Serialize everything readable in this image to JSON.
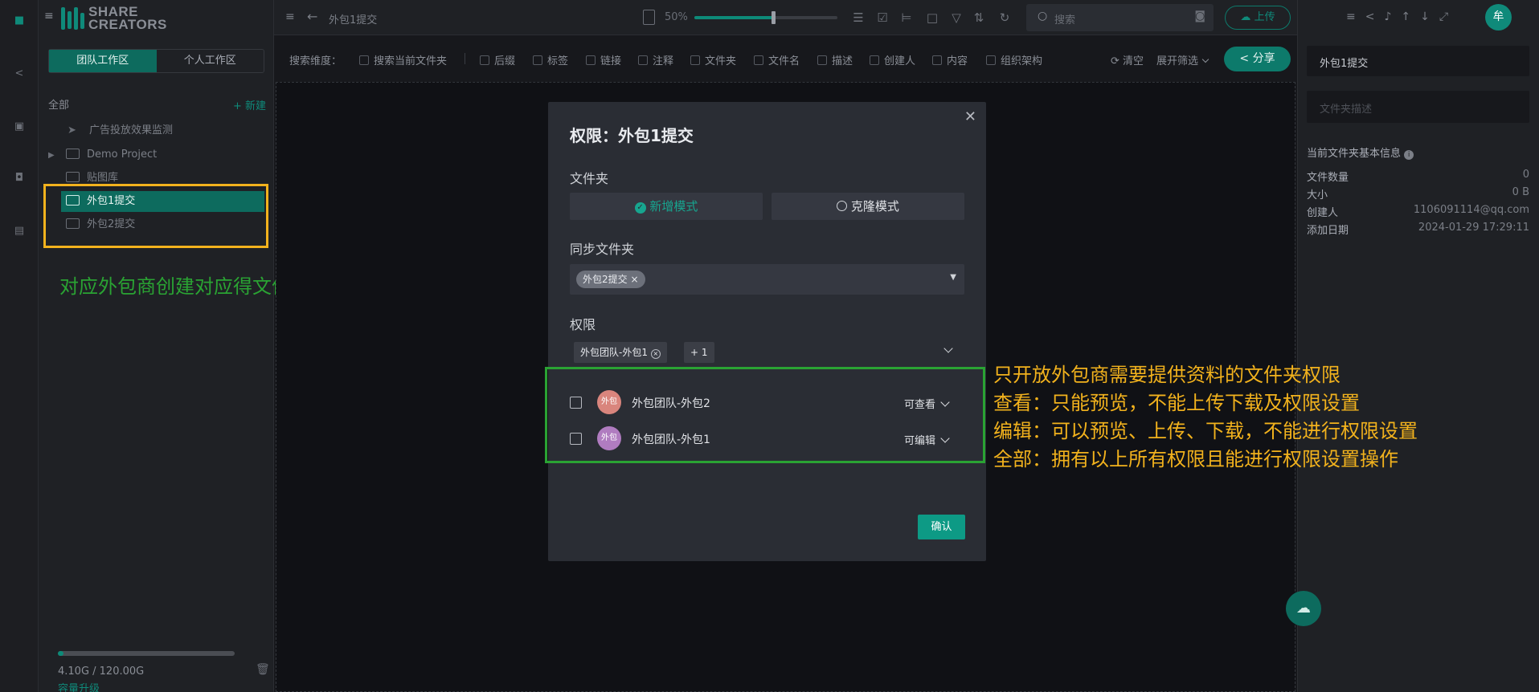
{
  "app": {
    "logo_line1": "SHARE",
    "logo_line2": "CREATORS"
  },
  "rail": {
    "icons": [
      "home-icon",
      "share-icon",
      "box-icon",
      "robot-icon",
      "archive-icon"
    ]
  },
  "sidebar": {
    "tabs": [
      "团队工作区",
      "个人工作区"
    ],
    "all_label": "全部",
    "new_label": "+ 新建",
    "items": [
      {
        "label": "广告投放效果监测"
      },
      {
        "label": "Demo Project"
      },
      {
        "label": "贴图库"
      },
      {
        "label": "外包1提交"
      },
      {
        "label": "外包2提交"
      }
    ],
    "storage_text": "4.10G / 120.00G",
    "storage_ratio": 0.034,
    "upgrade_label": "容量升级"
  },
  "topbar": {
    "breadcrumb": "外包1提交",
    "zoom": "50%",
    "zoom_ratio": 0.55,
    "search_placeholder": "搜索",
    "upload_label": "上传",
    "avatar": "牟"
  },
  "filters": {
    "label": "搜索维度：",
    "options": [
      "搜索当前文件夹",
      "后缀",
      "标签",
      "链接",
      "注释",
      "文件夹",
      "文件名",
      "描述",
      "创建人",
      "内容",
      "组织架构"
    ],
    "clear": "清空",
    "expand": "展开筛选",
    "share": "分享"
  },
  "right_panel": {
    "folder_name": "外包1提交",
    "desc_placeholder": "文件夹描述",
    "section_title": "当前文件夹基本信息",
    "rows": [
      {
        "k": "文件数量",
        "v": "0"
      },
      {
        "k": "大小",
        "v": "0 B"
      },
      {
        "k": "创建人",
        "v": "1106091114@qq.com"
      },
      {
        "k": "添加日期",
        "v": "2024-01-29 17:29:11"
      }
    ]
  },
  "modal": {
    "title": "权限：外包1提交",
    "folder_label": "文件夹",
    "mode_add": "新增模式",
    "mode_clone": "克隆模式",
    "sync_label": "同步文件夹",
    "sync_tag": "外包2提交",
    "perm_label": "权限",
    "perm_tag": "外包团队-外包1",
    "perm_more": "+ 1",
    "members": [
      {
        "avatar": "外包",
        "name": "外包团队-外包2",
        "role": "可查看",
        "color": "#d9857d"
      },
      {
        "avatar": "外包",
        "name": "外包团队-外包1",
        "role": "可编辑",
        "color": "#b07cc0"
      }
    ],
    "confirm": "确认"
  },
  "annotations": {
    "left_note": "对应外包商创建对应得文件夹",
    "right_notes": [
      "只开放外包商需要提供资料的文件夹权限",
      "查看：只能预览，不能上传下载及权限设置",
      "编辑：可以预览、上传、下载，不能进行权限设置",
      "全部：拥有以上所有权限且能进行权限设置操作"
    ]
  },
  "colors": {
    "accent": "#0d6b5e",
    "annotation_yellow": "#f2b21d",
    "annotation_green": "#2aa333"
  }
}
